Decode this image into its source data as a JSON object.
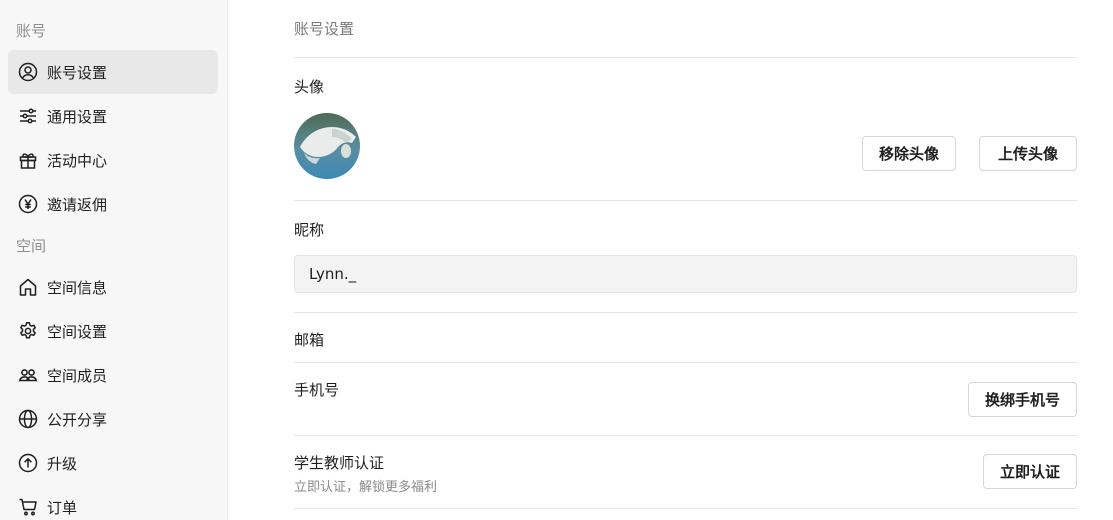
{
  "sidebar": {
    "account_section": "账号",
    "account_items": [
      {
        "label": "账号设置",
        "icon": "user-circle-icon"
      },
      {
        "label": "通用设置",
        "icon": "sliders-icon"
      },
      {
        "label": "活动中心",
        "icon": "gift-icon"
      },
      {
        "label": "邀请返佣",
        "icon": "yen-circle-icon"
      }
    ],
    "space_section": "空间",
    "space_items": [
      {
        "label": "空间信息",
        "icon": "home-icon"
      },
      {
        "label": "空间设置",
        "icon": "gear-icon"
      },
      {
        "label": "空间成员",
        "icon": "members-icon"
      },
      {
        "label": "公开分享",
        "icon": "globe-icon"
      },
      {
        "label": "升级",
        "icon": "arrow-up-circle-icon"
      },
      {
        "label": "订单",
        "icon": "cart-icon"
      }
    ]
  },
  "main": {
    "title": "账号设置",
    "avatar": {
      "label": "头像",
      "remove_button": "移除头像",
      "upload_button": "上传头像"
    },
    "nickname": {
      "label": "昵称",
      "value": "Lynn._"
    },
    "email": {
      "label": "邮箱"
    },
    "phone": {
      "label": "手机号",
      "rebind_button": "换绑手机号"
    },
    "verification": {
      "label": "学生教师认证",
      "subtitle": "立即认证，解锁更多福利",
      "button": "立即认证"
    }
  }
}
